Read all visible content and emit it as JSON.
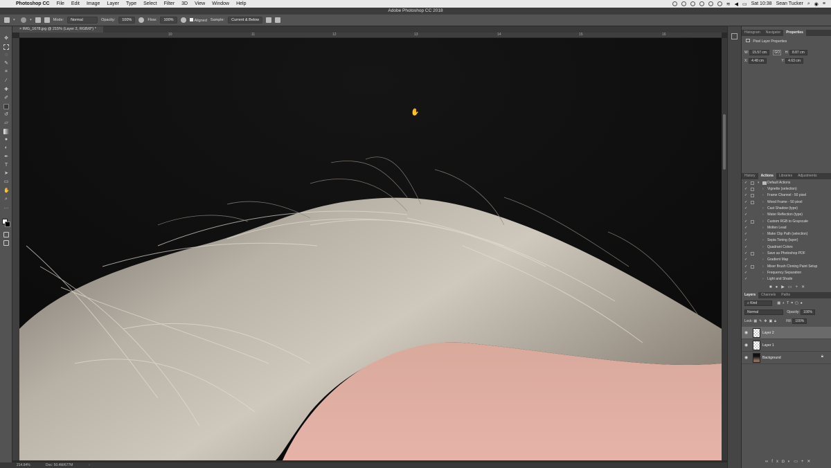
{
  "menubar": {
    "app_name": "Photoshop CC",
    "items": [
      "File",
      "Edit",
      "Image",
      "Layer",
      "Type",
      "Select",
      "Filter",
      "3D",
      "View",
      "Window",
      "Help"
    ],
    "clock": "Sat 10:38",
    "user": "Sean Tucker"
  },
  "window": {
    "title": "Adobe Photoshop CC 2018"
  },
  "options": {
    "mode_label": "Mode:",
    "mode_value": "Normal",
    "opacity_label": "Opacity:",
    "opacity_value": "100%",
    "flow_label": "Flow:",
    "flow_value": "100%",
    "aligned_label": "Aligned",
    "sample_label": "Sample:",
    "sample_value": "Current & Below"
  },
  "document": {
    "tab_title": "IMG_1678.jpg @ 215% (Layer 2, RGB/8*) *"
  },
  "status": {
    "zoom": "214.84%",
    "doc": "Doc: 50.4M/677M"
  },
  "properties": {
    "tabs": [
      "Histogram",
      "Navigator",
      "Properties"
    ],
    "active_tab": "Properties",
    "heading": "Pixel Layer Properties",
    "w": "15.57 cm",
    "h": "8.87 cm",
    "x": "4.48 cm",
    "y": "4.63 cm",
    "labels": {
      "w": "W:",
      "h": "H:",
      "x": "X:",
      "y": "Y:",
      "link": "GO"
    }
  },
  "actions": {
    "tabs": [
      "History",
      "Actions",
      "Libraries",
      "Adjustments"
    ],
    "active_tab": "Actions",
    "set_name": "Default Actions",
    "items": [
      "Vignette (selection)",
      "Frame Channel - 50 pixel",
      "Wood Frame - 50 pixel",
      "Cast Shadow (type)",
      "Water Reflection (type)",
      "Custom RGB to Grayscale",
      "Molten Lead",
      "Make Clip Path (selection)",
      "Sepia Toning (layer)",
      "Quadrant Colors",
      "Save as Photoshop PDF",
      "Gradient Map",
      "Mixer Brush Cloning Paint Setup",
      "Frequency Separation",
      "Light and Shade"
    ]
  },
  "layers": {
    "tabs": [
      "Layers",
      "Channels",
      "Paths"
    ],
    "active_tab": "Layers",
    "filter_kind": "Kind",
    "blend_mode": "Normal",
    "opacity_label": "Opacity:",
    "opacity_value": "100%",
    "lock_label": "Lock:",
    "fill_label": "Fill:",
    "fill_value": "100%",
    "items": [
      {
        "name": "Layer 2",
        "selected": true
      },
      {
        "name": "Layer 1",
        "selected": false
      },
      {
        "name": "Background",
        "selected": false
      }
    ]
  },
  "ruler": {
    "h_ticks": [
      "10",
      "11",
      "12",
      "13",
      "14",
      "15",
      "16"
    ]
  }
}
